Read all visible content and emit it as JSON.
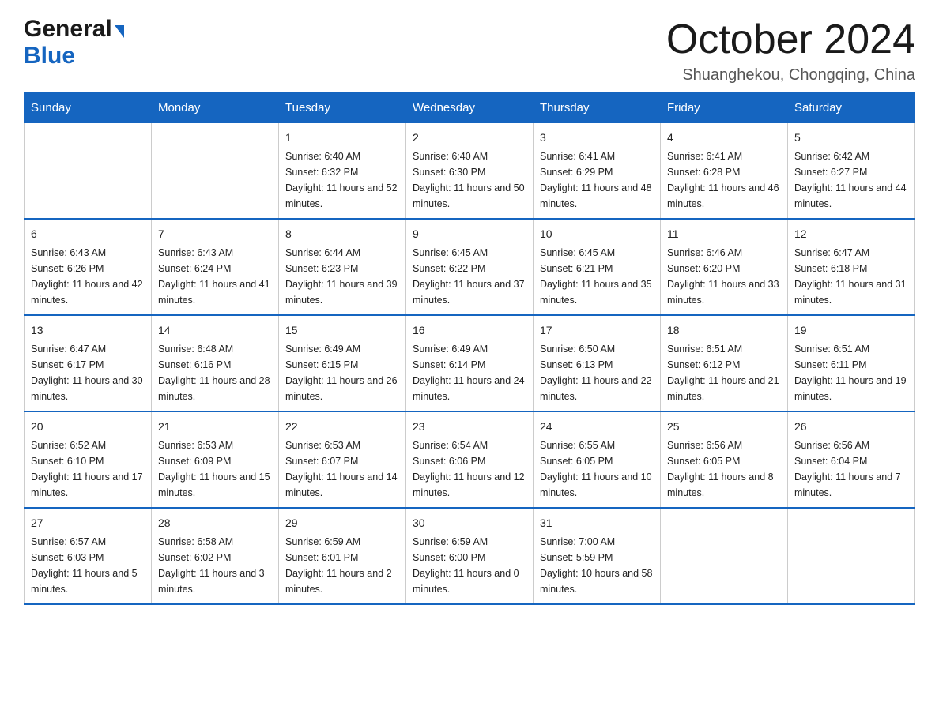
{
  "header": {
    "logo_general": "General",
    "logo_blue": "Blue",
    "month_title": "October 2024",
    "location": "Shuanghekou, Chongqing, China"
  },
  "weekdays": [
    "Sunday",
    "Monday",
    "Tuesday",
    "Wednesday",
    "Thursday",
    "Friday",
    "Saturday"
  ],
  "weeks": [
    [
      {
        "day": "",
        "sunrise": "",
        "sunset": "",
        "daylight": ""
      },
      {
        "day": "",
        "sunrise": "",
        "sunset": "",
        "daylight": ""
      },
      {
        "day": "1",
        "sunrise": "Sunrise: 6:40 AM",
        "sunset": "Sunset: 6:32 PM",
        "daylight": "Daylight: 11 hours and 52 minutes."
      },
      {
        "day": "2",
        "sunrise": "Sunrise: 6:40 AM",
        "sunset": "Sunset: 6:30 PM",
        "daylight": "Daylight: 11 hours and 50 minutes."
      },
      {
        "day": "3",
        "sunrise": "Sunrise: 6:41 AM",
        "sunset": "Sunset: 6:29 PM",
        "daylight": "Daylight: 11 hours and 48 minutes."
      },
      {
        "day": "4",
        "sunrise": "Sunrise: 6:41 AM",
        "sunset": "Sunset: 6:28 PM",
        "daylight": "Daylight: 11 hours and 46 minutes."
      },
      {
        "day": "5",
        "sunrise": "Sunrise: 6:42 AM",
        "sunset": "Sunset: 6:27 PM",
        "daylight": "Daylight: 11 hours and 44 minutes."
      }
    ],
    [
      {
        "day": "6",
        "sunrise": "Sunrise: 6:43 AM",
        "sunset": "Sunset: 6:26 PM",
        "daylight": "Daylight: 11 hours and 42 minutes."
      },
      {
        "day": "7",
        "sunrise": "Sunrise: 6:43 AM",
        "sunset": "Sunset: 6:24 PM",
        "daylight": "Daylight: 11 hours and 41 minutes."
      },
      {
        "day": "8",
        "sunrise": "Sunrise: 6:44 AM",
        "sunset": "Sunset: 6:23 PM",
        "daylight": "Daylight: 11 hours and 39 minutes."
      },
      {
        "day": "9",
        "sunrise": "Sunrise: 6:45 AM",
        "sunset": "Sunset: 6:22 PM",
        "daylight": "Daylight: 11 hours and 37 minutes."
      },
      {
        "day": "10",
        "sunrise": "Sunrise: 6:45 AM",
        "sunset": "Sunset: 6:21 PM",
        "daylight": "Daylight: 11 hours and 35 minutes."
      },
      {
        "day": "11",
        "sunrise": "Sunrise: 6:46 AM",
        "sunset": "Sunset: 6:20 PM",
        "daylight": "Daylight: 11 hours and 33 minutes."
      },
      {
        "day": "12",
        "sunrise": "Sunrise: 6:47 AM",
        "sunset": "Sunset: 6:18 PM",
        "daylight": "Daylight: 11 hours and 31 minutes."
      }
    ],
    [
      {
        "day": "13",
        "sunrise": "Sunrise: 6:47 AM",
        "sunset": "Sunset: 6:17 PM",
        "daylight": "Daylight: 11 hours and 30 minutes."
      },
      {
        "day": "14",
        "sunrise": "Sunrise: 6:48 AM",
        "sunset": "Sunset: 6:16 PM",
        "daylight": "Daylight: 11 hours and 28 minutes."
      },
      {
        "day": "15",
        "sunrise": "Sunrise: 6:49 AM",
        "sunset": "Sunset: 6:15 PM",
        "daylight": "Daylight: 11 hours and 26 minutes."
      },
      {
        "day": "16",
        "sunrise": "Sunrise: 6:49 AM",
        "sunset": "Sunset: 6:14 PM",
        "daylight": "Daylight: 11 hours and 24 minutes."
      },
      {
        "day": "17",
        "sunrise": "Sunrise: 6:50 AM",
        "sunset": "Sunset: 6:13 PM",
        "daylight": "Daylight: 11 hours and 22 minutes."
      },
      {
        "day": "18",
        "sunrise": "Sunrise: 6:51 AM",
        "sunset": "Sunset: 6:12 PM",
        "daylight": "Daylight: 11 hours and 21 minutes."
      },
      {
        "day": "19",
        "sunrise": "Sunrise: 6:51 AM",
        "sunset": "Sunset: 6:11 PM",
        "daylight": "Daylight: 11 hours and 19 minutes."
      }
    ],
    [
      {
        "day": "20",
        "sunrise": "Sunrise: 6:52 AM",
        "sunset": "Sunset: 6:10 PM",
        "daylight": "Daylight: 11 hours and 17 minutes."
      },
      {
        "day": "21",
        "sunrise": "Sunrise: 6:53 AM",
        "sunset": "Sunset: 6:09 PM",
        "daylight": "Daylight: 11 hours and 15 minutes."
      },
      {
        "day": "22",
        "sunrise": "Sunrise: 6:53 AM",
        "sunset": "Sunset: 6:07 PM",
        "daylight": "Daylight: 11 hours and 14 minutes."
      },
      {
        "day": "23",
        "sunrise": "Sunrise: 6:54 AM",
        "sunset": "Sunset: 6:06 PM",
        "daylight": "Daylight: 11 hours and 12 minutes."
      },
      {
        "day": "24",
        "sunrise": "Sunrise: 6:55 AM",
        "sunset": "Sunset: 6:05 PM",
        "daylight": "Daylight: 11 hours and 10 minutes."
      },
      {
        "day": "25",
        "sunrise": "Sunrise: 6:56 AM",
        "sunset": "Sunset: 6:05 PM",
        "daylight": "Daylight: 11 hours and 8 minutes."
      },
      {
        "day": "26",
        "sunrise": "Sunrise: 6:56 AM",
        "sunset": "Sunset: 6:04 PM",
        "daylight": "Daylight: 11 hours and 7 minutes."
      }
    ],
    [
      {
        "day": "27",
        "sunrise": "Sunrise: 6:57 AM",
        "sunset": "Sunset: 6:03 PM",
        "daylight": "Daylight: 11 hours and 5 minutes."
      },
      {
        "day": "28",
        "sunrise": "Sunrise: 6:58 AM",
        "sunset": "Sunset: 6:02 PM",
        "daylight": "Daylight: 11 hours and 3 minutes."
      },
      {
        "day": "29",
        "sunrise": "Sunrise: 6:59 AM",
        "sunset": "Sunset: 6:01 PM",
        "daylight": "Daylight: 11 hours and 2 minutes."
      },
      {
        "day": "30",
        "sunrise": "Sunrise: 6:59 AM",
        "sunset": "Sunset: 6:00 PM",
        "daylight": "Daylight: 11 hours and 0 minutes."
      },
      {
        "day": "31",
        "sunrise": "Sunrise: 7:00 AM",
        "sunset": "Sunset: 5:59 PM",
        "daylight": "Daylight: 10 hours and 58 minutes."
      },
      {
        "day": "",
        "sunrise": "",
        "sunset": "",
        "daylight": ""
      },
      {
        "day": "",
        "sunrise": "",
        "sunset": "",
        "daylight": ""
      }
    ]
  ]
}
